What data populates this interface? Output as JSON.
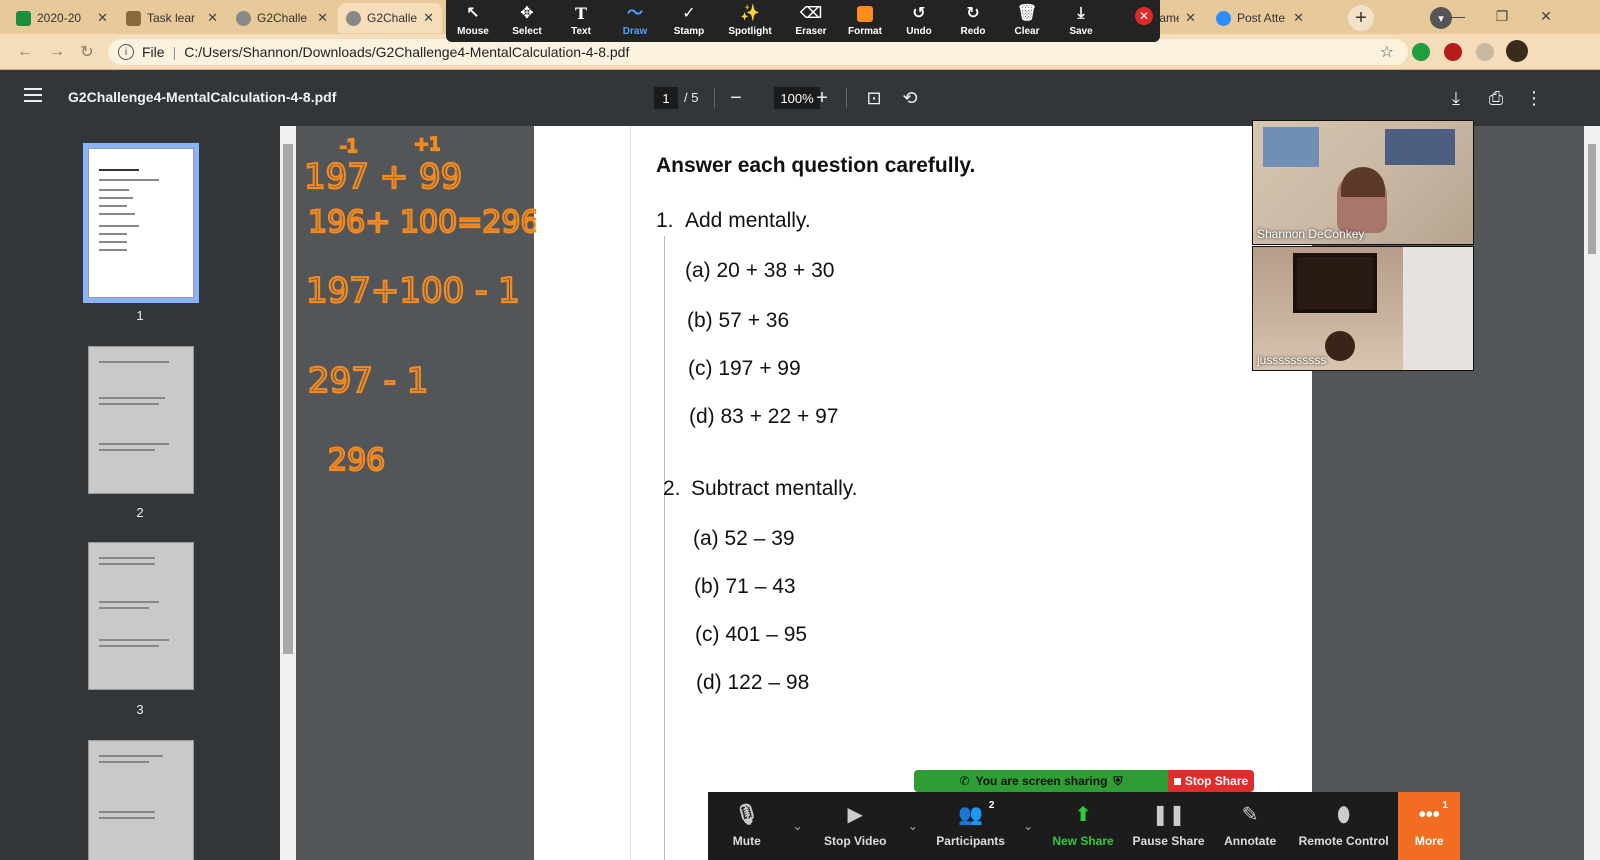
{
  "browser": {
    "tabs": [
      {
        "label": "2020-20",
        "favicon_color": "#1e8e3e"
      },
      {
        "label": "Task lear",
        "favicon_color": "#8a6a3a"
      },
      {
        "label": "G2Challe",
        "favicon_color": "#888888"
      },
      {
        "label": "G2Challe",
        "favicon_color": "#888888"
      },
      {
        "label": "0 frame",
        "favicon_color": "#999999"
      },
      {
        "label": "Post Atte",
        "favicon_color": "#2d8cff"
      }
    ],
    "tab_close": "✕",
    "new_tab": "+",
    "address_prefix": "File",
    "address": "C:/Users/Shannon/Downloads/G2Challenge4-MentalCalculation-4-8.pdf"
  },
  "annotation_toolbar": {
    "tools": [
      {
        "label": "Mouse",
        "icon": "↖"
      },
      {
        "label": "Select",
        "icon": "✥"
      },
      {
        "label": "Text",
        "icon": "T"
      },
      {
        "label": "Draw",
        "icon": "〜"
      },
      {
        "label": "Stamp",
        "icon": "✓"
      },
      {
        "label": "Spotlight",
        "icon": "✨"
      },
      {
        "label": "Eraser",
        "icon": "⌫"
      },
      {
        "label": "Format",
        "icon": ""
      },
      {
        "label": "Undo",
        "icon": "↺"
      },
      {
        "label": "Redo",
        "icon": "↻"
      },
      {
        "label": "Clear",
        "icon": "🗑"
      },
      {
        "label": "Save",
        "icon": "⤓"
      }
    ],
    "active_tool": "Draw",
    "close": "✕"
  },
  "pdf": {
    "title": "G2Challenge4-MentalCalculation-4-8.pdf",
    "current_page": "1",
    "total_pages": "/ 5",
    "zoom": "100%",
    "thumbnails": [
      "1",
      "2",
      "3"
    ],
    "heading": "Answer each question carefully.",
    "q1_title": "1.",
    "q1_label": "Add mentally.",
    "q1_items": [
      "(a)  20 + 38 + 30",
      "(b)  57 + 36",
      "(c)  197 + 99",
      "(d)  83 + 22 + 97"
    ],
    "q2_title": "2.",
    "q2_label": "Subtract mentally.",
    "q2_items": [
      "(a)  52 – 39",
      "(b)  71 – 43",
      "(c)  401 – 95",
      "(d)  122 – 98"
    ]
  },
  "ink_annotations": {
    "line0_marks": [
      "-1",
      "+1"
    ],
    "lines": [
      "197 + 99",
      "196+ 100=296",
      "197+100 - 1",
      "297 - 1",
      "296"
    ],
    "color": "#f58a1f"
  },
  "video": {
    "participant1": "Shannon DeConkey",
    "participant2": "jussssssssss"
  },
  "share": {
    "banner": "You are screen sharing",
    "stop": "Stop Share"
  },
  "zoom_controls": {
    "mute": "Mute",
    "stop_video": "Stop Video",
    "participants": "Participants",
    "participants_count": "2",
    "new_share": "New Share",
    "pause_share": "Pause Share",
    "annotate": "Annotate",
    "remote_control": "Remote Control",
    "more": "More",
    "more_badge": "1"
  }
}
